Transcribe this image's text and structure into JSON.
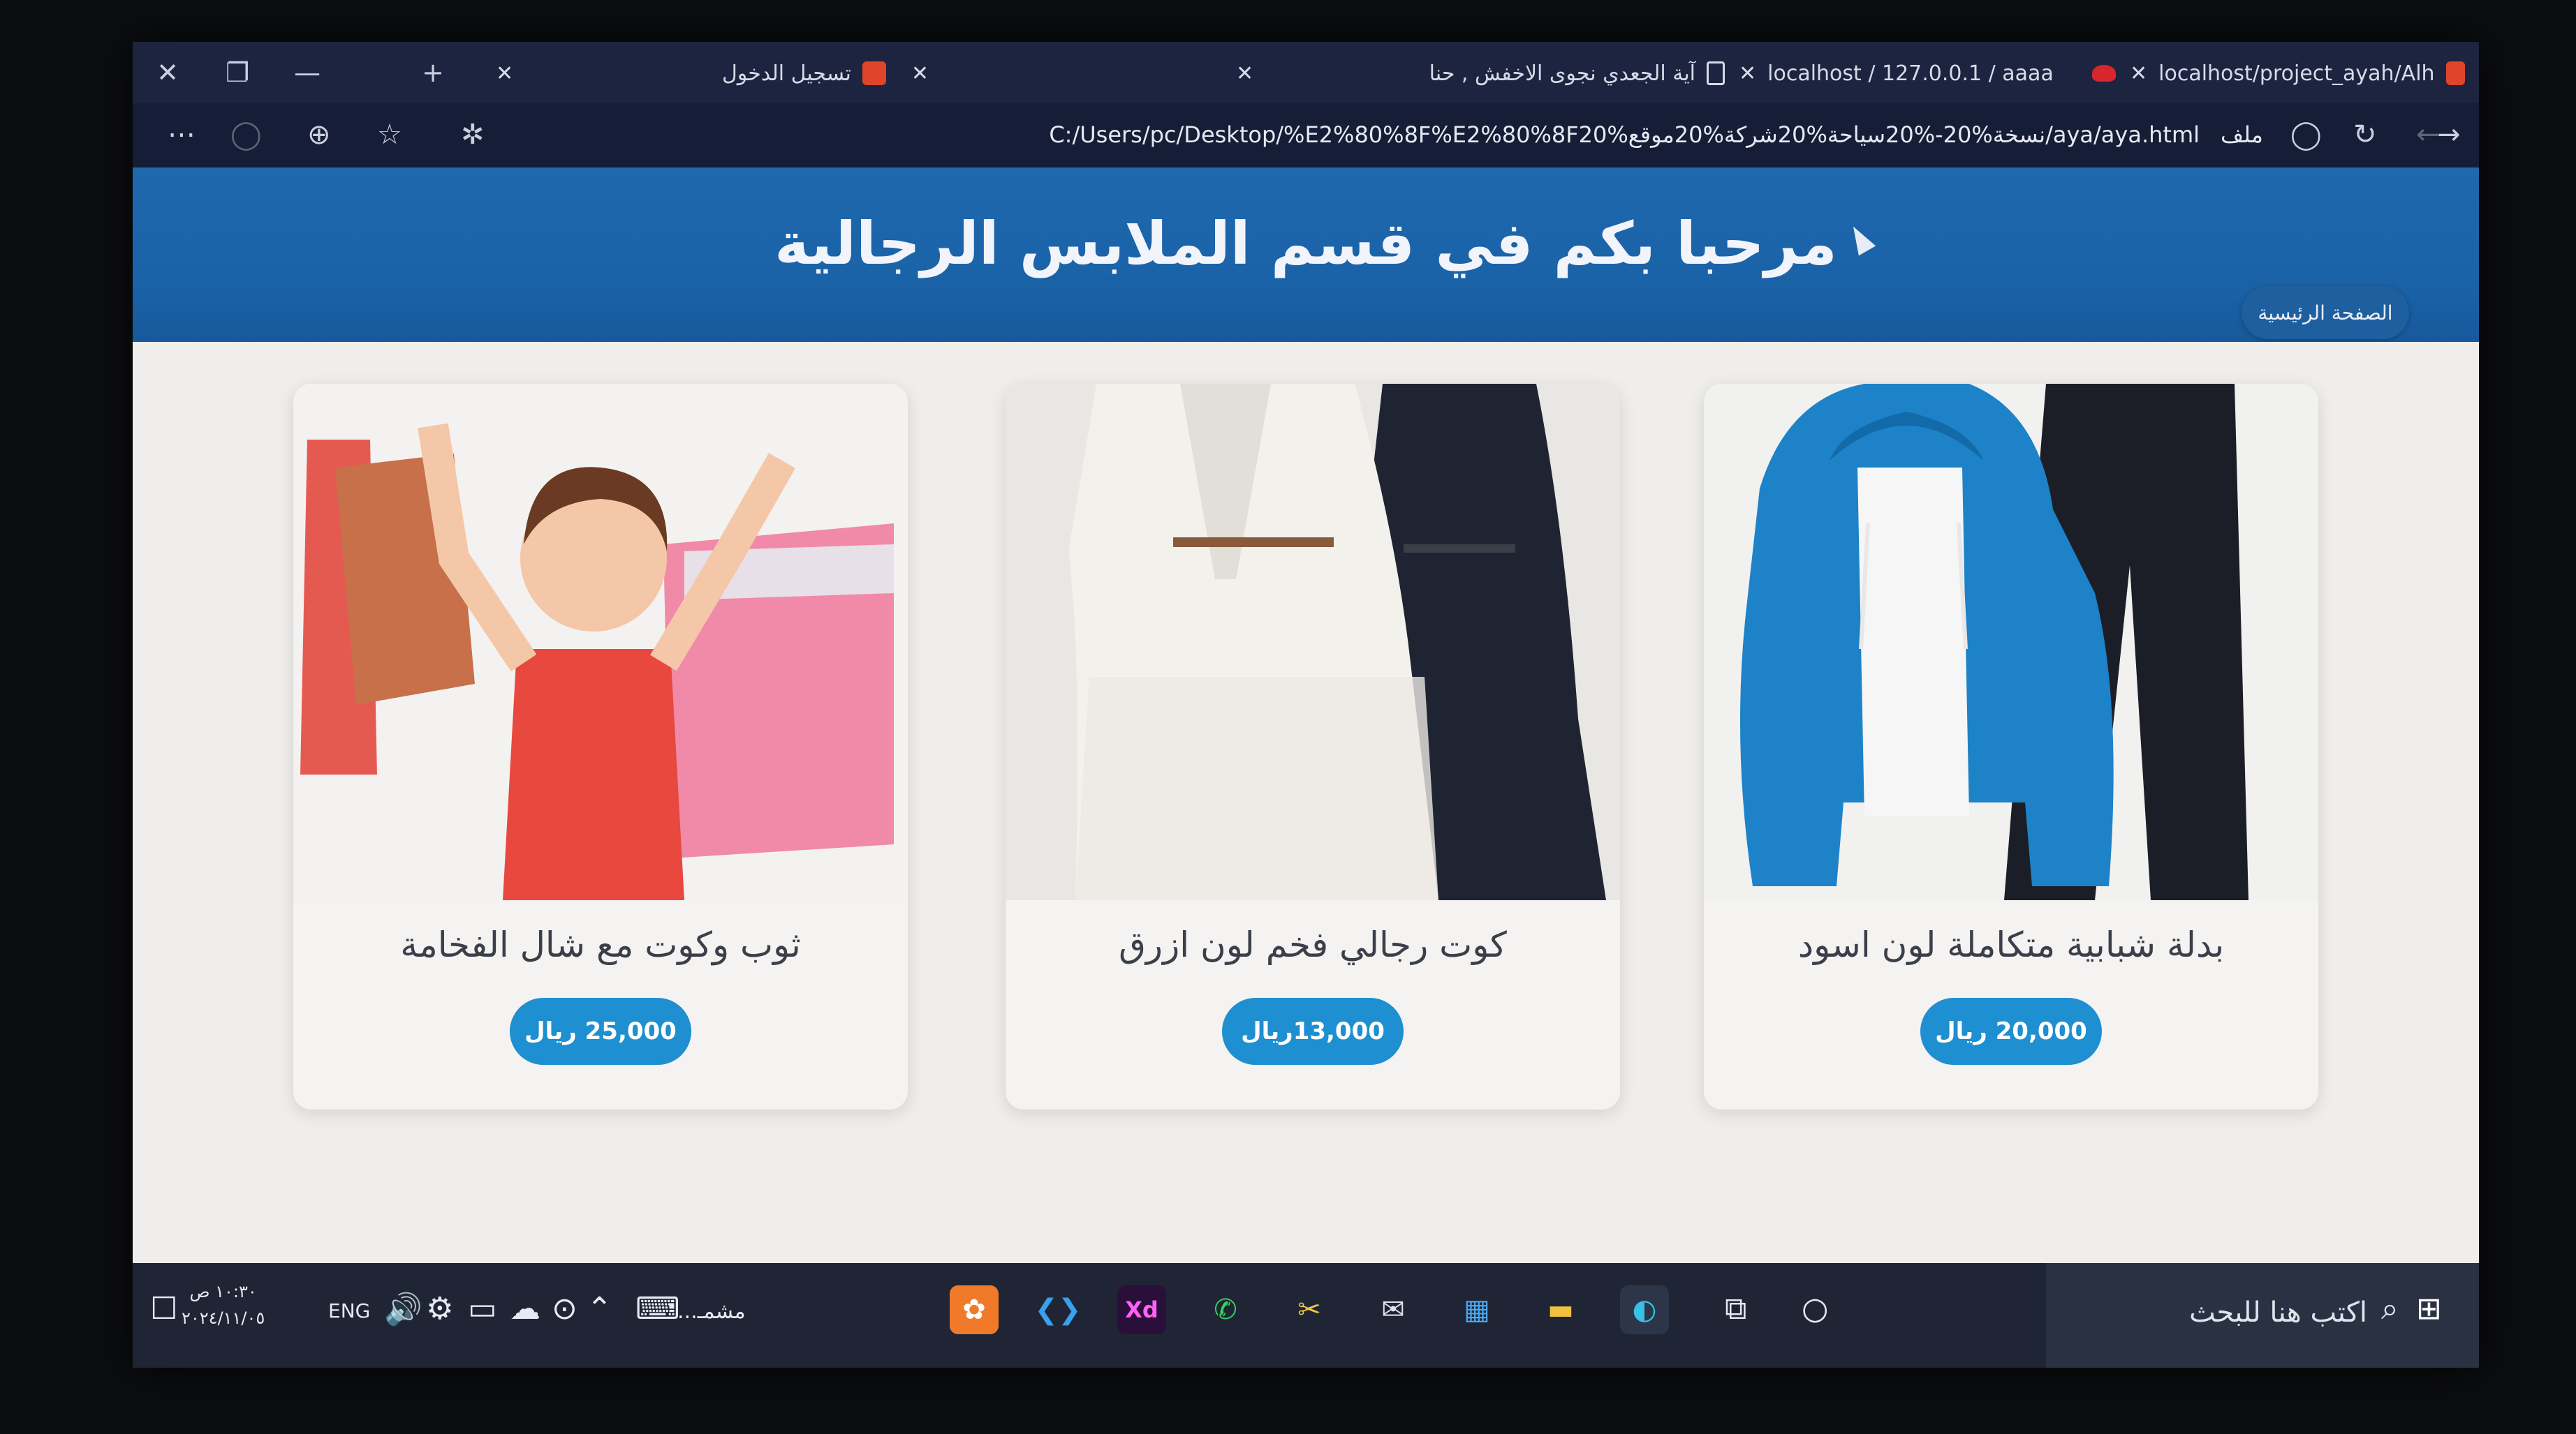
{
  "browser": {
    "tabs": [
      {
        "label": "تسجيل الدخول"
      },
      {
        "label": "آية الجعدي نجوى الاخفش , حنا"
      },
      {
        "label": "localhost / 127.0.0.1 / aaaa"
      },
      {
        "label": "localhost/project_ayah/Alh"
      }
    ],
    "url": "C:/Users/pc/Desktop/%E2%80%8F%E2%80%8Fنسخة%20-%20سياحة%20شركة%20موقع%20/aya/aya.html",
    "file_label": "ملف"
  },
  "header": {
    "title": "مرحبا بكم في قسم الملابس الرجالية",
    "home_label": "الصفحة الرئيسية"
  },
  "products": [
    {
      "name": "بدلة شبابية متكاملة لون اسود",
      "price": "20,000 ريال"
    },
    {
      "name": "كوت رجالي فخم لون ازرق",
      "price": "13,000ريال"
    },
    {
      "name": "ثوب وكوت مع شال الفخامة",
      "price": "25,000 ريال"
    }
  ],
  "taskbar": {
    "search_placeholder": "اكتب هنا للبحث",
    "time": "١٠:٣٠ ص",
    "date": "٢٠٢٤/١١/٠٥",
    "lang": "ENG",
    "weather": "مشمـ...",
    "xd_label": "Xd"
  },
  "colors": {
    "header_blue": "#1f68ad",
    "price_button": "#1e8fd0"
  }
}
